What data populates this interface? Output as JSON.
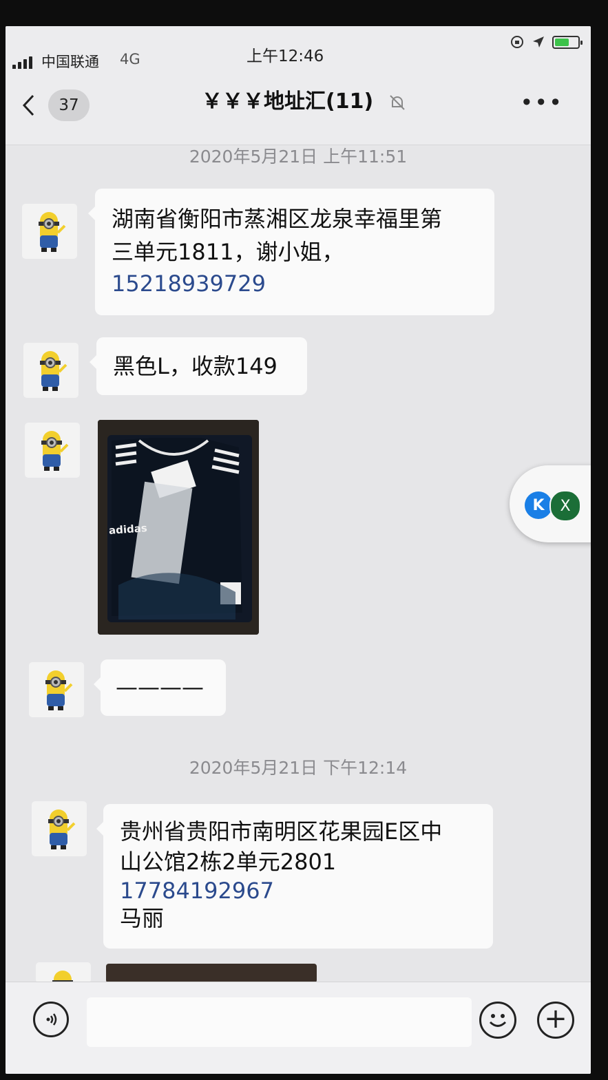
{
  "status_bar": {
    "carrier": "中国联通",
    "network": "4G",
    "time": "上午12:46"
  },
  "nav": {
    "unread_count": "37",
    "title": "￥￥￥地址汇(11)",
    "icons": [
      "back-chevron-icon",
      "mute-bell-icon",
      "more-icon"
    ]
  },
  "messages": [
    {
      "type": "timestamp",
      "text": "2020年5月21日 上午11:51"
    },
    {
      "type": "text",
      "lines": [
        "湖南省衡阳市蒸湘区龙泉幸福里第",
        "三单元1811，谢小姐，"
      ],
      "phone": "15218939729"
    },
    {
      "type": "text",
      "lines": [
        "黑色L，收款149"
      ]
    },
    {
      "type": "image",
      "label": "adidas"
    },
    {
      "type": "text",
      "lines": [
        "————"
      ]
    },
    {
      "type": "timestamp",
      "text": "2020年5月21日 下午12:14"
    },
    {
      "type": "text",
      "lines": [
        "贵州省贵阳市南明区花果园E区中",
        "山公馆2栋2单元2801"
      ],
      "phone": "17784192967",
      "after": "马丽"
    },
    {
      "type": "image",
      "label": ""
    }
  ],
  "floating_widget": {
    "k": "K",
    "x": "X"
  },
  "input_bar": {
    "icons": [
      "voice-icon",
      "emoji-icon",
      "plus-icon"
    ],
    "value": ""
  },
  "colors": {
    "phone_link": "#2b4a8d",
    "bubble": "#fafafa",
    "background": "#e6e6e8"
  }
}
